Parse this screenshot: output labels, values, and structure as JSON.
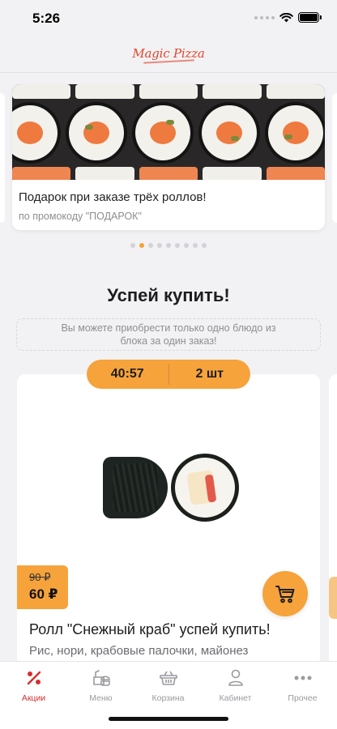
{
  "status": {
    "time": "5:26"
  },
  "header": {
    "logo_text": "Magic Pizza"
  },
  "promo": {
    "title": "Подарок при заказе трёх роллов!",
    "subtitle": "по промокоду \"ПОДАРОК\""
  },
  "pager": {
    "count": 9,
    "active_index": 1
  },
  "section": {
    "title": "Успей купить!",
    "info": "Вы можете приобрести только одно блюдо из блока за один заказ!"
  },
  "product": {
    "timer": "40:57",
    "quantity": "2 шт",
    "old_price": "90 ₽",
    "new_price": "60 ₽",
    "name": "Ролл \"Снежный краб\" успей купить!",
    "description": "Рис, нори, крабовые палочки, майонез"
  },
  "tabs": [
    {
      "label": "Акции",
      "icon": "percent-icon",
      "active": true
    },
    {
      "label": "Меню",
      "icon": "food-icon",
      "active": false
    },
    {
      "label": "Корзина",
      "icon": "basket-icon",
      "active": false
    },
    {
      "label": "Кабинет",
      "icon": "user-icon",
      "active": false
    },
    {
      "label": "Прочее",
      "icon": "more-icon",
      "active": false
    }
  ],
  "colors": {
    "accent": "#f6a33c",
    "active_tab": "#d72f2f",
    "logo": "#e2452d"
  }
}
